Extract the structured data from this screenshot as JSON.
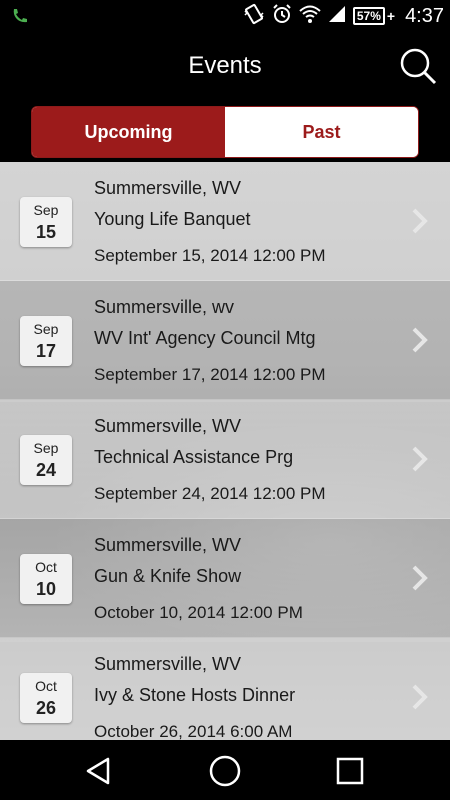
{
  "status_bar": {
    "battery": "57%",
    "time": "4:37",
    "icons": [
      "phone-icon",
      "vibrate-icon",
      "alarm-icon",
      "wifi-icon",
      "signal-icon",
      "battery-icon"
    ]
  },
  "header": {
    "title": "Events",
    "search_icon": "search-icon"
  },
  "tabs": [
    {
      "label": "Upcoming",
      "selected": true
    },
    {
      "label": "Past",
      "selected": false
    }
  ],
  "events": [
    {
      "month": "Sep",
      "day": "15",
      "location": "Summersville, WV",
      "title": "Young Life Banquet",
      "datetime": "September 15, 2014 12:00 PM"
    },
    {
      "month": "Sep",
      "day": "17",
      "location": "Summersville, wv",
      "title": "WV Int' Agency Council Mtg",
      "datetime": "September 17, 2014 12:00 PM"
    },
    {
      "month": "Sep",
      "day": "24",
      "location": "Summersville, WV",
      "title": "Technical Assistance Prg",
      "datetime": "September 24, 2014 12:00 PM"
    },
    {
      "month": "Oct",
      "day": "10",
      "location": "Summersville, WV",
      "title": "Gun & Knife Show",
      "datetime": "October 10, 2014 12:00 PM"
    },
    {
      "month": "Oct",
      "day": "26",
      "location": "Summersville, WV",
      "title": "Ivy & Stone Hosts Dinner",
      "datetime": "October 26, 2014 6:00 AM"
    }
  ],
  "nav_bar": {
    "icons": [
      "back-icon",
      "home-icon",
      "recents-icon"
    ]
  },
  "colors": {
    "accent": "#9c1b1b",
    "background": "#000000"
  }
}
